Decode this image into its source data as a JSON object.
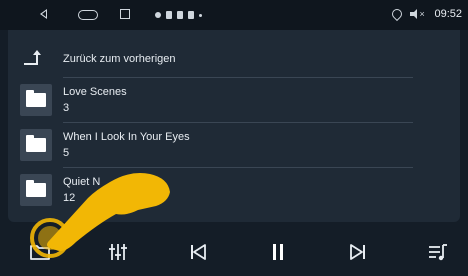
{
  "status_bar": {
    "time": "09:52",
    "icons": [
      "back-nav-icon",
      "home-nav-icon",
      "recent-apps-icon",
      "location-icon",
      "volume-muted-icon"
    ]
  },
  "list": {
    "back_label": "Zurück zum vorherigen",
    "folders": [
      {
        "name": "Love Scenes",
        "count": "3"
      },
      {
        "name": "When I Look In Your Eyes",
        "count": "5"
      },
      {
        "name": "Quiet N",
        "count": "12"
      }
    ]
  },
  "bottom_bar": {
    "buttons": [
      "folder-icon",
      "equalizer-icon",
      "previous-icon",
      "pause-icon",
      "next-icon",
      "playlist-icon"
    ]
  },
  "colors": {
    "background": "#141d27",
    "panel": "#1f2a36",
    "folder_tile": "#3a4654",
    "hand_overlay": "#f2b705"
  }
}
